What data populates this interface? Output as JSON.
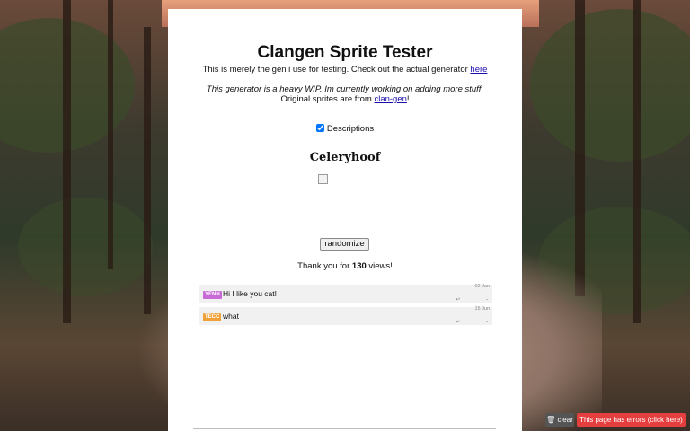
{
  "page": {
    "title": "Clangen Sprite Tester",
    "intro_text": "This is merely the gen i use for testing. Check out the actual generator ",
    "intro_link": "here",
    "wip_text": "This generator is a heavy WIP. Im currently working on adding more stuff.",
    "credit_text": "Original sprites are from ",
    "credit_link": "clan-gen",
    "credit_suffix": "!",
    "descriptions_label": "Descriptions",
    "descriptions_checked": true,
    "cat_name": "Celeryhoof",
    "randomize_label": "randomize",
    "views_prefix": "Thank you for ",
    "views_count": "130",
    "views_suffix": " views!"
  },
  "comments": [
    {
      "tag": "YENN",
      "tag_color": "#c86bd6",
      "text": "Hi I like you cat!",
      "date": "02 Jan",
      "arrow": "↩",
      "dash": "-"
    },
    {
      "tag": "TECC",
      "tag_color": "#f0a23a",
      "text": "what",
      "date": "15 Jun",
      "arrow": "↩",
      "dash": "-"
    }
  ],
  "footer": {
    "clear_label": "🗑 clear",
    "error_label": "This page has errors (click here)"
  }
}
